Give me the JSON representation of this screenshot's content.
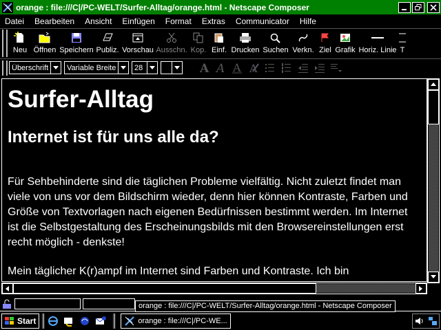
{
  "window": {
    "title": "orange : file:///C|/PC-WELT/Surfer-Alltag/orange.html - Netscape Composer",
    "buttons": {
      "minimize": "_",
      "maximize": "□",
      "close": "×"
    }
  },
  "menubar": {
    "items": [
      "Datei",
      "Bearbeiten",
      "Ansicht",
      "Einfügen",
      "Format",
      "Extras",
      "Communicator",
      "Hilfe"
    ]
  },
  "toolbar": {
    "buttons": [
      {
        "label": "Neu",
        "icon": "new-page-icon",
        "enabled": true
      },
      {
        "label": "Öffnen",
        "icon": "open-folder-icon",
        "enabled": true
      },
      {
        "label": "Speichern",
        "icon": "save-disk-icon",
        "enabled": true
      },
      {
        "label": "Publiz.",
        "icon": "publish-icon",
        "enabled": true
      },
      {
        "label": "Vorschau",
        "icon": "preview-icon",
        "enabled": true
      },
      {
        "label": "Ausschn.",
        "icon": "cut-scissors-icon",
        "enabled": false
      },
      {
        "label": "Kop.",
        "icon": "copy-icon",
        "enabled": false
      },
      {
        "label": "Einf.",
        "icon": "paste-icon",
        "enabled": true
      },
      {
        "label": "Drucken",
        "icon": "print-icon",
        "enabled": true
      },
      {
        "label": "Suchen",
        "icon": "find-icon",
        "enabled": true
      },
      {
        "label": "Verkn.",
        "icon": "link-icon",
        "enabled": true
      },
      {
        "label": "Ziel",
        "icon": "target-icon",
        "enabled": true
      },
      {
        "label": "Grafik",
        "icon": "image-icon",
        "enabled": true
      },
      {
        "label": "Horiz. Linie",
        "icon": "horizontal-line-icon",
        "enabled": true
      },
      {
        "label": "T",
        "icon": "table-icon",
        "enabled": true
      }
    ]
  },
  "formatbar": {
    "paragraph_style": "Überschrift",
    "font": "Variable Breite",
    "font_size": "28",
    "color_swatch": "#000000"
  },
  "document": {
    "heading1": "Surfer-Alltag",
    "heading2": "Internet ist für uns alle da?",
    "paragraph1": "Für Sehbehinderte sind die täglichen Probleme vielfältig. Nicht zuletzt findet man viele von uns vor dem Bildschirm wieder, denn hier können Kontraste, Farben und Größe von Textvorlagen nach eigenen Bedürfnissen bestimmt werden. Im Internet ist die Selbstgestaltung des Erscheinungsbilds mit den Browsereinstellungen erst recht möglich - denkste!",
    "paragraph2": "Mein täglicher K(r)ampf im Internet sind Farben und Kontraste. Ich bin"
  },
  "tooltip": "orange : file:///C|/PC-WELT/Surfer-Alltag/orange.html - Netscape Composer",
  "taskbar": {
    "start_label": "Start",
    "task_label": "orange : file:///C|/PC-WE...",
    "time": ""
  },
  "colors": {
    "titlebar": "#008000",
    "background": "#000000",
    "text": "#ffffff"
  }
}
